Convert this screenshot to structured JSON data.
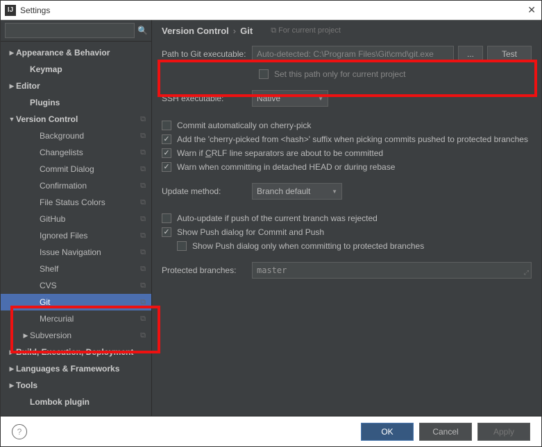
{
  "window": {
    "title": "Settings"
  },
  "search": {
    "placeholder": ""
  },
  "sidebar": [
    {
      "label": "Appearance & Behavior",
      "level": 0,
      "arrow": "right",
      "bold": true
    },
    {
      "label": "Keymap",
      "level": 1,
      "bold": true
    },
    {
      "label": "Editor",
      "level": 0,
      "arrow": "right",
      "bold": true
    },
    {
      "label": "Plugins",
      "level": 1,
      "bold": true
    },
    {
      "label": "Version Control",
      "level": 0,
      "arrow": "down",
      "bold": true,
      "copy": true
    },
    {
      "label": "Background",
      "level": 2,
      "copy": true
    },
    {
      "label": "Changelists",
      "level": 2,
      "copy": true
    },
    {
      "label": "Commit Dialog",
      "level": 2,
      "copy": true
    },
    {
      "label": "Confirmation",
      "level": 2,
      "copy": true
    },
    {
      "label": "File Status Colors",
      "level": 2,
      "copy": true
    },
    {
      "label": "GitHub",
      "level": 2,
      "copy": true
    },
    {
      "label": "Ignored Files",
      "level": 2,
      "copy": true
    },
    {
      "label": "Issue Navigation",
      "level": 2,
      "copy": true
    },
    {
      "label": "Shelf",
      "level": 2,
      "copy": true
    },
    {
      "label": "CVS",
      "level": 2,
      "copy": true
    },
    {
      "label": "Git",
      "level": 2,
      "copy": true,
      "selected": true
    },
    {
      "label": "Mercurial",
      "level": 2,
      "copy": true
    },
    {
      "label": "Subversion",
      "level": 1,
      "arrow": "right",
      "copy": true
    },
    {
      "label": "Build, Execution, Deployment",
      "level": 0,
      "arrow": "right",
      "bold": true
    },
    {
      "label": "Languages & Frameworks",
      "level": 0,
      "arrow": "right",
      "bold": true
    },
    {
      "label": "Tools",
      "level": 0,
      "arrow": "right",
      "bold": true
    },
    {
      "label": "Lombok plugin",
      "level": 1,
      "bold": true
    }
  ],
  "breadcrumb": {
    "a": "Version Control",
    "b": "Git",
    "hint": "For current project"
  },
  "path_row": {
    "label": "Path to Git executable:",
    "value": "Auto-detected: C:\\Program Files\\Git\\cmd\\git.exe",
    "browse": "...",
    "test": "Test"
  },
  "set_path_only": {
    "label": "Set this path only for current project",
    "checked": false
  },
  "ssh_row": {
    "label": "SSH executable:",
    "value": "Native"
  },
  "checks": {
    "cherry_auto": {
      "label": "Commit automatically on cherry-pick",
      "checked": false
    },
    "cherry_suffix": {
      "label": "Add the 'cherry-picked from <hash>' suffix when picking commits pushed to protected branches",
      "checked": true
    },
    "crlf_pre": "Warn if ",
    "crlf_u": "C",
    "crlf_post": "RLF line separators are about to be committed",
    "crlf_checked": true,
    "detached": {
      "label": "Warn when committing in detached HEAD or during rebase",
      "checked": true
    }
  },
  "update_row": {
    "label": "Update method:",
    "value": "Branch default"
  },
  "auto_update": {
    "label": "Auto-update if push of the current branch was rejected",
    "checked": false
  },
  "show_push": {
    "label": "Show Push dialog for Commit and Push",
    "checked": true
  },
  "show_push_protected": {
    "label": "Show Push dialog only when committing to protected branches",
    "checked": false
  },
  "protected_row": {
    "label": "Protected branches:",
    "value": "master"
  },
  "footer": {
    "help": "?",
    "ok": "OK",
    "cancel": "Cancel",
    "apply": "Apply"
  }
}
